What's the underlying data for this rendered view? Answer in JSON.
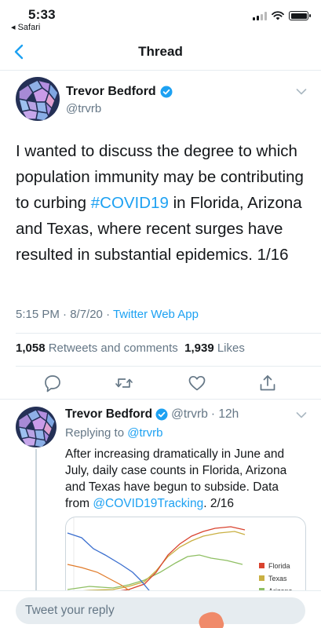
{
  "status": {
    "time": "5:33",
    "back_app": "◂ Safari"
  },
  "nav": {
    "title": "Thread",
    "back_icon": "chevron-left-icon"
  },
  "main_tweet": {
    "name": "Trevor Bedford",
    "handle": "@trvrb",
    "text_before": "I wanted to discuss the degree to which population immunity may be contributing to curbing ",
    "hashtag": "#COVID19",
    "text_after": " in Florida, Arizona and Texas, where recent surges have resulted in substantial epidemics. 1/16",
    "time": "5:15 PM · 8/7/20 · ",
    "source": "Twitter Web App",
    "retweets_count": "1,058",
    "retweets_label": " Retweets and comments  ",
    "likes_count": "1,939",
    "likes_label": " Likes",
    "actions": [
      "reply-icon",
      "retweet-icon",
      "like-icon",
      "share-icon"
    ]
  },
  "reply_tweet": {
    "name": "Trevor Bedford",
    "handle": "@trvrb",
    "age": "· 12h",
    "replying_prefix": "Replying to ",
    "replying_to": "@trvrb",
    "text_before": "After increasing dramatically in June and July, daily case counts in Florida, Arizona and Texas have begun to subside. Data from ",
    "mention": "@COVID19Tracking",
    "text_after": ". 2/16",
    "chart": {
      "legend": [
        "Florida",
        "Texas",
        "Arizona"
      ],
      "colors": {
        "florida": "#d9432f",
        "texas": "#c9b043",
        "arizona": "#8fbf63",
        "blue": "#3b6fcf"
      }
    }
  },
  "composer": {
    "placeholder": "Tweet your reply"
  },
  "colors": {
    "accent": "#1da1f2",
    "secondary_text": "#657786",
    "divider": "#e6ecf0"
  }
}
